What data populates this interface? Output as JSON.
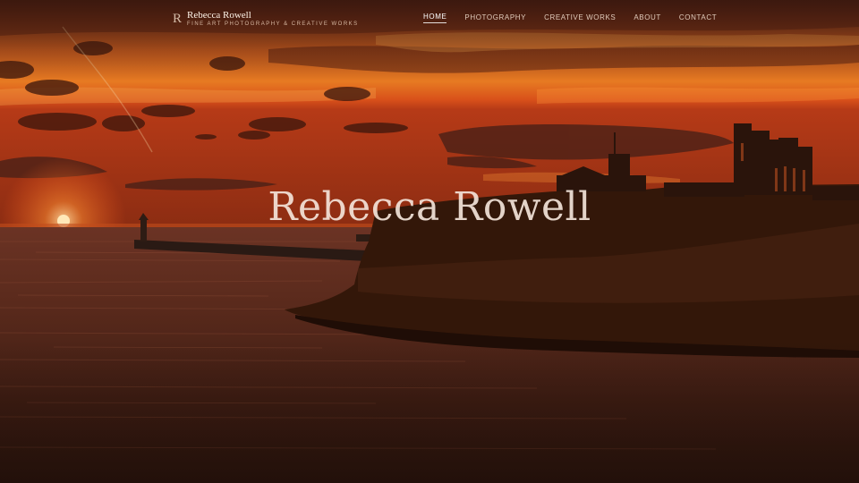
{
  "brand": {
    "mark": "R",
    "name": "Rebecca Rowell",
    "tagline": "FINE ART PHOTOGRAPHY & CREATIVE WORKS"
  },
  "nav": {
    "home": "HOME",
    "photography": "PHOTOGRAPHY",
    "creative_works": "CREATIVE WORKS",
    "about": "ABOUT",
    "contact": "CONTACT",
    "active": "home"
  },
  "hero": {
    "title": "Rebecca Rowell",
    "description": ""
  },
  "colors": {
    "sky_top": "#5a2416",
    "sky_mid": "#e1661e",
    "horizon": "#f08a22",
    "sun": "#ffe6a8",
    "sea": "#3a1c12",
    "cliff": "#2b140b"
  }
}
